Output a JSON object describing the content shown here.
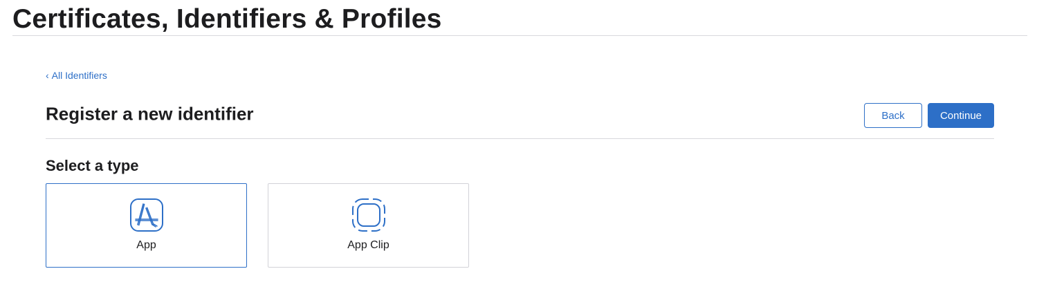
{
  "header": {
    "title": "Certificates, Identifiers & Profiles"
  },
  "breadcrumb": {
    "chevron": "‹",
    "label": "All Identifiers"
  },
  "section": {
    "title": "Register a new identifier",
    "back_label": "Back",
    "continue_label": "Continue"
  },
  "type_selector": {
    "title": "Select a type",
    "options": [
      {
        "label": "App",
        "icon": "app-store-icon",
        "selected": true
      },
      {
        "label": "App Clip",
        "icon": "app-clip-icon",
        "selected": false
      }
    ]
  },
  "colors": {
    "accent": "#2d6fc7",
    "text": "#1d1d1f",
    "divider": "#d8d8dc"
  }
}
